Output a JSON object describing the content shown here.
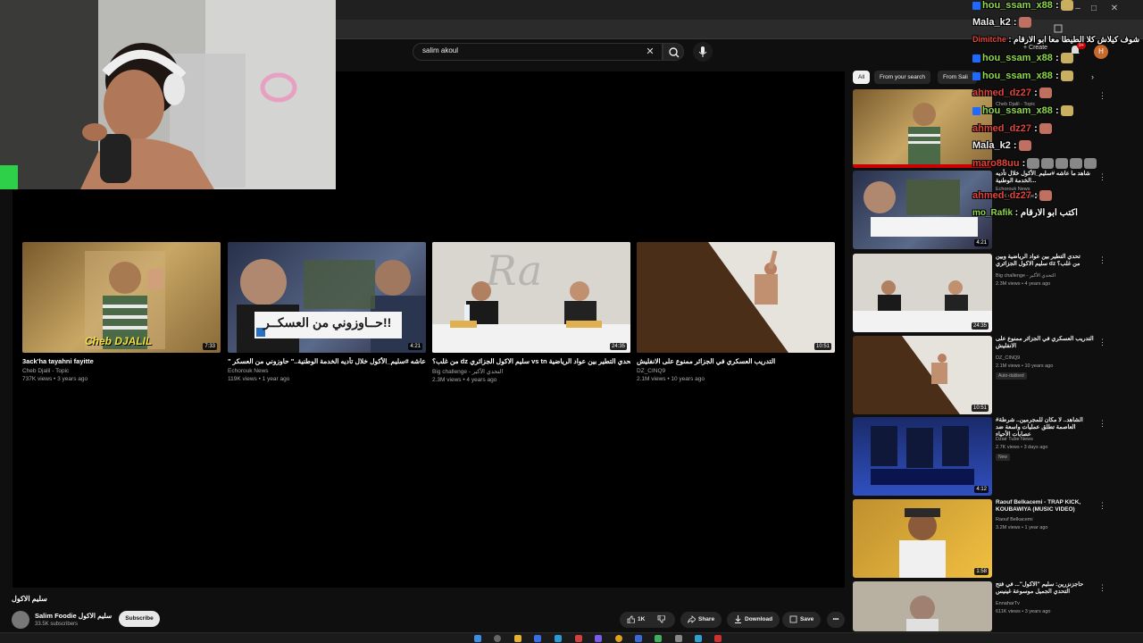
{
  "browser": {
    "window_controls": [
      "–",
      "□",
      "✕"
    ]
  },
  "search": {
    "query": "salim akoul",
    "clear_icon": "close-icon",
    "search_icon": "search-icon",
    "mic_icon": "mic-icon"
  },
  "header": {
    "create_label": "+ Create",
    "bell_badge": "9+",
    "avatar_letter": "H"
  },
  "chips": [
    "All",
    "From your search",
    "From Sali"
  ],
  "end_cards": [
    {
      "title": "3ack'ha tayahni fayitte",
      "channel": "Cheb Djalil - Topic",
      "meta": "737K views • 3 years ago",
      "duration": "7:33",
      "thumb_text": "Cheb DJALIL"
    },
    {
      "title": "\" شاهد ما عاشه #سليم_الأكول خلال تأديه الخدمة الوطنية..\" حاوزوني من العسكر",
      "channel": "Echorouk News",
      "meta": "119K views • 1 year ago",
      "duration": "4:21",
      "thumb_text": "حــاوزوني من العسكــر!!"
    },
    {
      "title": "من غلب؟ dz سليم الاكول الجزائري vs tn تحدي التطير بين عواد الرياضية",
      "channel": "Big challenge - التحدي الأكبر",
      "meta": "2.3M views • 4 years ago",
      "duration": "24:35",
      "thumb_text": ""
    },
    {
      "title": "التدريب العسكري في الجزائر ممنوع على الانفليش",
      "channel": "DZ_CINQ9",
      "meta": "2.1M views • 10 years ago",
      "duration": "10:51",
      "thumb_text": ""
    }
  ],
  "video": {
    "title": "سليم الاكول",
    "channel_name": "Salim Foodie سليم الاكول",
    "subscribers": "33.5K subscribers",
    "subscribe_label": "Subscribe",
    "likes": "1K",
    "share_label": "Share",
    "download_label": "Download",
    "save_label": "Save",
    "more_label": "•••"
  },
  "sidebar": [
    {
      "title": "",
      "channel": "Cheb Djalil - Topic",
      "meta": "",
      "duration": "",
      "badge": ""
    },
    {
      "title": "شاهد ما عاشه #سليم_الأكول خلال تأديه الخدمة الوطنية...",
      "channel": "Echorouk News",
      "meta": "119K views • 1 year ago",
      "duration": "4:21",
      "badge": ""
    },
    {
      "title": "تحدي التطير بين عواد الرياضية وبين سليم الاكول الجزائري dz من غلب؟",
      "channel": "Big challenge - التحدي الأكبر",
      "meta": "2.3M views • 4 years ago",
      "duration": "24:35",
      "badge": ""
    },
    {
      "title": "التدريب العسكري في الجزائر ممنوع على الانفليش",
      "channel": "DZ_CINQ9",
      "meta": "2.1M views • 10 years ago",
      "duration": "10:51",
      "badge": "Auto-dubbed"
    },
    {
      "title": "#الشاهد.. لا مكان للمجرمين.. شرطة العاصمة تطلق عمليات واسعة ضد عصابات الأحياء",
      "channel": "Dzair Tube News",
      "meta": "2.7K views • 3 days ago",
      "duration": "4:12",
      "badge": "New"
    },
    {
      "title": "Raouf Belkacemi - TRAP KICK, KOUBAWIYA (MUSIC VIDEO)",
      "channel": "Raouf Belkacemi",
      "meta": "3.2M views • 1 year ago",
      "duration": "1:58",
      "badge": ""
    },
    {
      "title": "حاجزنزرين: سليم \"الأكول\"... في فتح التحدي الجميل موسوعة غينيس",
      "channel": "EnnaharTv",
      "meta": "611K views • 3 years ago",
      "duration": "",
      "badge": ""
    }
  ],
  "chat": [
    {
      "user": "hou_ssam_x88",
      "msg": ":",
      "color": "green",
      "badge": true
    },
    {
      "user": "Mala_k2",
      "msg": ":",
      "color": "white",
      "badge": false
    },
    {
      "user": "Dimitche",
      "msg": ": شوف كيلاش كلا الطيطا معا ابو الارقام",
      "color": "red",
      "badge": false
    },
    {
      "user": "hou_ssam_x88",
      "msg": ":",
      "color": "green",
      "badge": true
    },
    {
      "user": "hou_ssam_x88",
      "msg": ":",
      "color": "green",
      "badge": true
    },
    {
      "user": "ahmed_dz27",
      "msg": ":",
      "color": "red",
      "badge": false
    },
    {
      "user": "hou_ssam_x88",
      "msg": ":",
      "color": "green",
      "badge": true
    },
    {
      "user": "ahmed_dz27",
      "msg": ":",
      "color": "red",
      "badge": false
    },
    {
      "user": "Mala_k2",
      "msg": ":",
      "color": "white",
      "badge": false
    },
    {
      "user": "maro88uu",
      "msg": ":",
      "color": "red",
      "badge": false
    },
    {
      "user": "ahmed_dz27",
      "msg": ":",
      "color": "red",
      "badge": false
    },
    {
      "user": "mo_Rafik",
      "msg": ": اكتب ابو الارقام",
      "color": "green",
      "badge": false
    }
  ],
  "colors": {
    "background": "#0f0f0f",
    "accent_red": "#cc0000",
    "chat_green": "#8fd84a",
    "chat_red": "#e0453c"
  }
}
